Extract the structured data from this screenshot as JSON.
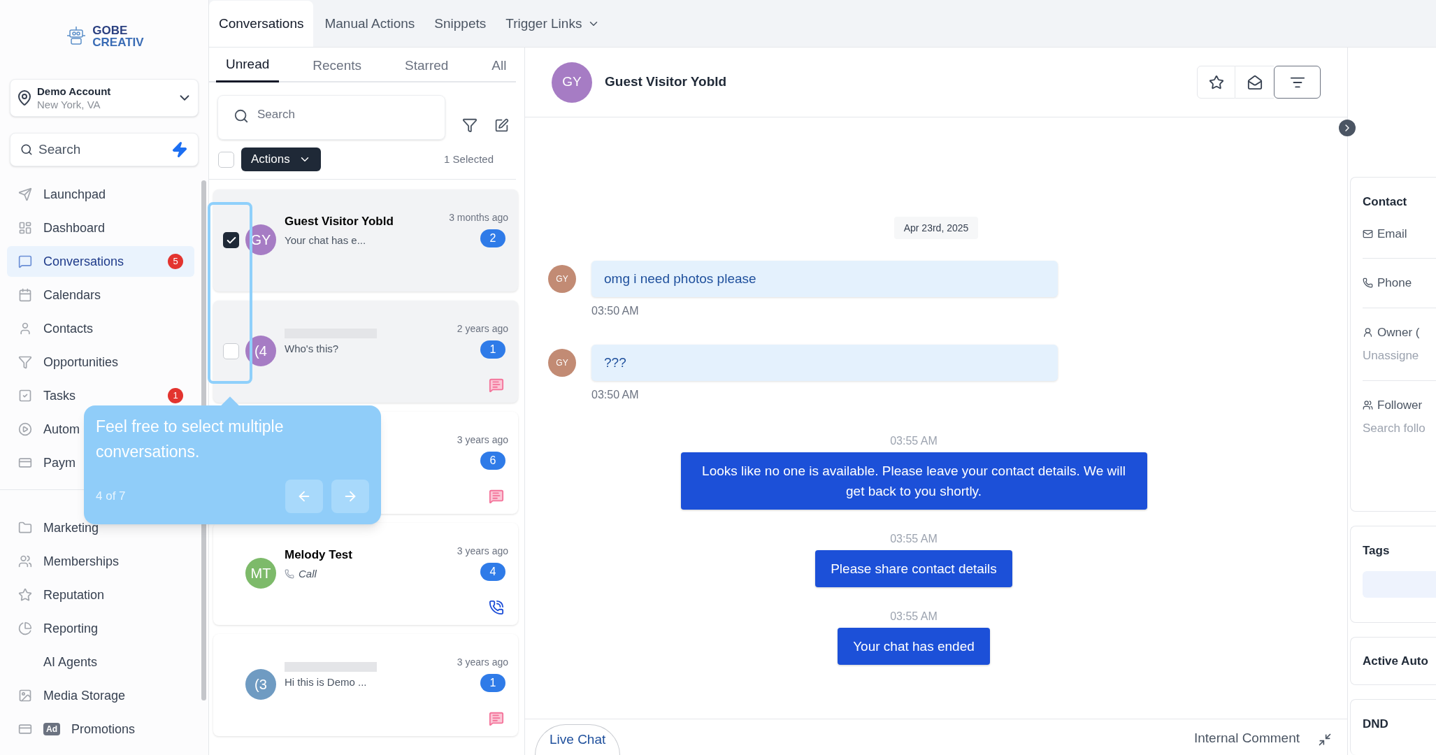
{
  "logo": {
    "line1": "GOBE",
    "line2": "CREATIV"
  },
  "account": {
    "name": "Demo Account",
    "location": "New York, VA"
  },
  "sidebar_search": {
    "placeholder": "Search"
  },
  "sidebar": {
    "primary": [
      {
        "label": "Launchpad",
        "selected": false
      },
      {
        "label": "Dashboard",
        "selected": false
      },
      {
        "label": "Conversations",
        "selected": true,
        "badge": "5"
      },
      {
        "label": "Calendars",
        "selected": false
      },
      {
        "label": "Contacts",
        "selected": false
      },
      {
        "label": "Opportunities",
        "selected": false
      },
      {
        "label": "Tasks",
        "selected": false,
        "badge": "1"
      },
      {
        "label": "Autom",
        "selected": false
      },
      {
        "label": "Paym",
        "selected": false
      }
    ],
    "secondary": [
      {
        "label": "Marketing",
        "selected": false
      },
      {
        "label": "Memberships",
        "selected": false
      },
      {
        "label": "Reputation",
        "selected": false
      },
      {
        "label": "Reporting",
        "selected": false
      },
      {
        "label": "AI Agents",
        "selected": false
      },
      {
        "label": "Media Storage",
        "selected": false
      },
      {
        "label": "Promotions",
        "selected": false,
        "tag": "Ad"
      }
    ]
  },
  "top_tabs": [
    {
      "label": "Conversations",
      "selected": true,
      "dropdown": false
    },
    {
      "label": "Manual Actions",
      "selected": false,
      "dropdown": false
    },
    {
      "label": "Snippets",
      "selected": false,
      "dropdown": false
    },
    {
      "label": "Trigger Links",
      "selected": false,
      "dropdown": true
    }
  ],
  "filter_tabs": [
    {
      "label": "Unread",
      "selected": true
    },
    {
      "label": "Recents",
      "selected": false
    },
    {
      "label": "Starred",
      "selected": false
    },
    {
      "label": "All",
      "selected": false
    }
  ],
  "list_search": {
    "placeholder": "Search"
  },
  "bulk": {
    "select_all_checked": false,
    "actions_label": "Actions",
    "selected_count": "1 Selected"
  },
  "conversations": [
    {
      "checked": true,
      "highlighted": true,
      "avatar": "GY",
      "color": "#a67cc4",
      "name": "Guest Visitor Yobld",
      "preview": "Your chat has e...",
      "time": "3 months ago",
      "unread": "2",
      "chat_icon": false,
      "call_icon": false
    },
    {
      "checked": false,
      "highlighted": true,
      "avatar": "(4",
      "color": "#a67cc4",
      "redacted": true,
      "preview": "Who's this?",
      "time": "2 years ago",
      "unread": "1",
      "chat_icon": true,
      "call_icon": false
    },
    {
      "highlighted": false,
      "time": "3 years ago",
      "unread": "6",
      "chat_icon": true,
      "call_icon": false
    },
    {
      "highlighted": false,
      "avatar": "MT",
      "color": "#7dba6a",
      "name": "Melody Test",
      "preview": "Call",
      "preview_call": true,
      "time": "3 years ago",
      "unread": "4",
      "chat_icon": false,
      "call_icon": true
    },
    {
      "highlighted": false,
      "avatar": "(3",
      "color": "#6f9bc2",
      "redacted": true,
      "preview": "Hi this is Demo ...",
      "time": "3 years ago",
      "unread": "1",
      "chat_icon": true,
      "call_icon": false
    }
  ],
  "tour": {
    "text": "Feel free to select multiple conversations.",
    "step": "4 of 7"
  },
  "chat": {
    "avatar": "GY",
    "name": "Guest Visitor Yobld",
    "date": "Apr 23rd, 2025",
    "messages": [
      {
        "kind": "inbound",
        "avatar": "GY",
        "color": "#c28b74",
        "text": "omg i need photos please",
        "time": "03:50 AM"
      },
      {
        "kind": "inbound",
        "avatar": "GY",
        "color": "#c28b74",
        "text": "???",
        "time": "03:50 AM"
      },
      {
        "kind": "outbound",
        "text": "Looks like no one is available. Please leave your contact details. We will get back to you shortly.",
        "time": "03:55 AM"
      },
      {
        "kind": "outbound",
        "text": "Please share contact details",
        "time": "03:55 AM"
      },
      {
        "kind": "outbound",
        "text": "Your chat has ended",
        "time": "03:55 AM"
      }
    ],
    "composer_tab": "Live Chat",
    "internal_comment": "Internal Comment"
  },
  "details": {
    "contact_title": "Contact",
    "fields": [
      {
        "kind": "email",
        "label": "Email"
      },
      {
        "kind": "phone",
        "label": "Phone"
      },
      {
        "kind": "owner",
        "label": "Owner (",
        "value": "Unassigne"
      },
      {
        "kind": "followers",
        "label": "Follower",
        "placeholder": "Search follo"
      }
    ],
    "tags_title": "Tags",
    "automations_title": "Active Auto",
    "dnd_title": "DND"
  }
}
